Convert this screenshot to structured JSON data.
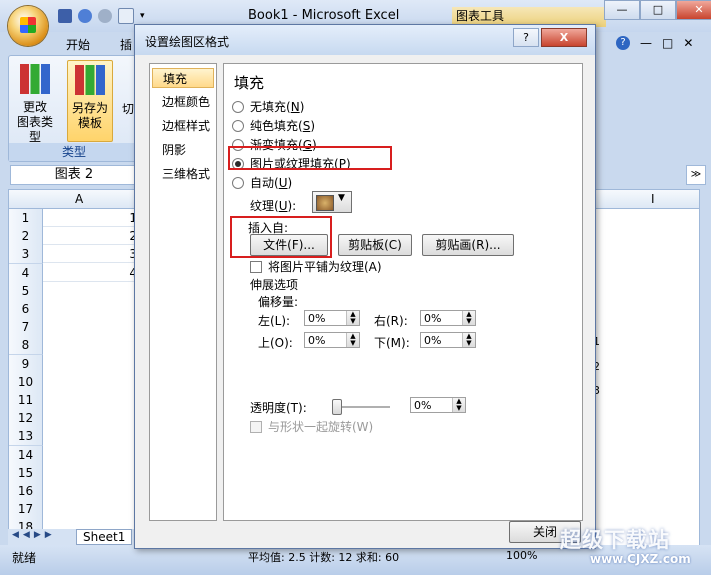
{
  "window": {
    "app_title": "Book1 - Microsoft Excel",
    "context_tab": "图表工具",
    "minimize": "—",
    "maximize": "□",
    "close": "✕"
  },
  "ribbon": {
    "tabs": [
      "开始",
      "插"
    ],
    "buttons": [
      {
        "label": "更改\n图表类型"
      },
      {
        "label": "另存为\n模板"
      }
    ],
    "cut_fragment": "切",
    "group_label": "类型",
    "right_controls": [
      "?",
      "—",
      "□",
      "✕"
    ]
  },
  "formula_bar": {
    "name_box": "图表 2",
    "expand": "≫"
  },
  "sheet": {
    "columns": [
      "A",
      "I"
    ],
    "rows": [
      "1",
      "2",
      "3",
      "4",
      "5",
      "6",
      "7",
      "8",
      "9",
      "10",
      "11",
      "12",
      "13",
      "14",
      "15",
      "16",
      "17",
      "18"
    ],
    "values_a": [
      "1",
      "2",
      "3",
      "4"
    ],
    "legend_fragments": [
      "1",
      "2",
      "3"
    ],
    "tab_name": "Sheet1"
  },
  "status": {
    "ready": "就绪",
    "stats": "平均值: 2.5   计数: 12   求和: 60",
    "zoom": "100%"
  },
  "dialog": {
    "title": "设置绘图区格式",
    "help": "?",
    "close": "X",
    "nav_items": [
      "填充",
      "边框颜色",
      "边框样式",
      "阴影",
      "三维格式"
    ],
    "selected_nav": "填充",
    "heading": "填充",
    "fill_options": [
      {
        "label": "无填充",
        "key": "N"
      },
      {
        "label": "纯色填充",
        "key": "S"
      },
      {
        "label": "渐变填充",
        "key": "G"
      },
      {
        "label": "图片或纹理填充",
        "key": "P"
      },
      {
        "label": "自动",
        "key": "U"
      }
    ],
    "texture_label": "纹理",
    "texture_key": "U",
    "insert_from": "插入自:",
    "btn_file": "文件(F)...",
    "btn_clipboard": "剪贴板(C)",
    "btn_clipart": "剪贴画(R)...",
    "tile_checkbox": "将图片平铺为纹理(A)",
    "stretch_options": "伸展选项",
    "offsets": "偏移量:",
    "left": "左(L):",
    "right": "右(R):",
    "top": "上(O):",
    "bottom": "下(M):",
    "left_val": "0%",
    "right_val": "0%",
    "top_val": "0%",
    "bottom_val": "0%",
    "transparency": "透明度(T):",
    "transparency_val": "0%",
    "rotate_checkbox": "与形状一起旋转(W)",
    "close_button": "关闭"
  },
  "watermark": {
    "text": "超级下载站",
    "url": "www.CJXZ.com"
  }
}
